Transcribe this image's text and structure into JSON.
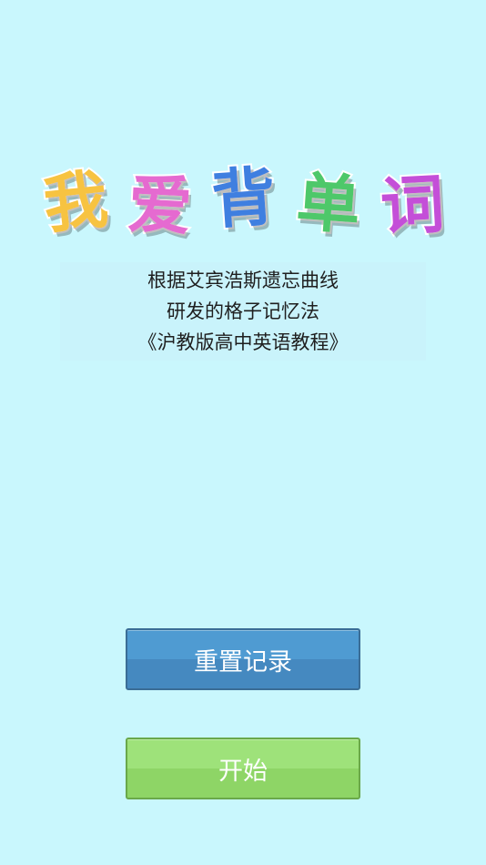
{
  "title": {
    "chars": [
      {
        "text": "我",
        "color": "#f7c341"
      },
      {
        "text": "爱",
        "color": "#e56ad0"
      },
      {
        "text": "背",
        "color": "#3f7fe0"
      },
      {
        "text": "单",
        "color": "#4ec86a"
      },
      {
        "text": "词",
        "color": "#c44fd8"
      }
    ]
  },
  "description": {
    "lines": [
      "根据艾宾浩斯遗忘曲线",
      "研发的格子记忆法",
      "《沪教版高中英语教程》"
    ]
  },
  "buttons": {
    "reset_label": "重置记录",
    "start_label": "开始"
  },
  "colors": {
    "background": "#c9f7fd",
    "reset_button": "#4f9bd2",
    "start_button": "#9ee27a"
  }
}
